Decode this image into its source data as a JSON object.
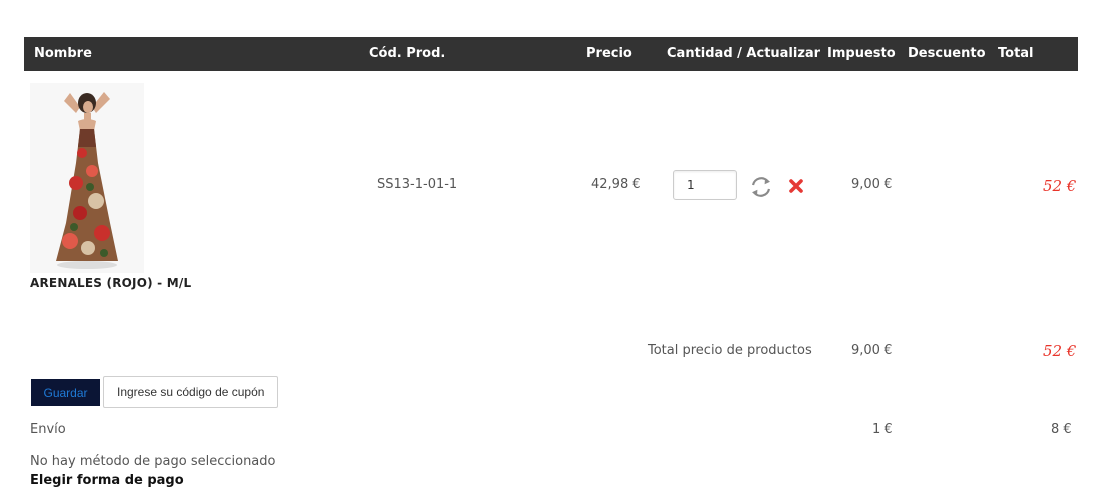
{
  "table": {
    "headers": {
      "name": "Nombre",
      "code": "Cód. Prod.",
      "price": "Precio",
      "quantity": "Cantidad / Actualizar",
      "tax": "Impuesto",
      "discount": "Descuento",
      "total": "Total"
    },
    "rows": [
      {
        "product_name": "ARENALES (ROJO) - M/L",
        "code": "SS13-1-01-1",
        "price": "42,98 €",
        "quantity": "1",
        "tax": "9,00 €",
        "total": "52 €"
      }
    ]
  },
  "icons": {
    "refresh": "refresh-icon",
    "remove": "close-icon"
  },
  "summary": {
    "label": "Total precio de productos",
    "tax": "9,00 €",
    "total": "52 €"
  },
  "coupon": {
    "save_label": "Guardar",
    "placeholder": "Ingrese su código de cupón"
  },
  "shipping": {
    "label": "Envío",
    "tax": "1 €",
    "total": "8 €"
  },
  "payment": {
    "status": "No hay método de pago seleccionado",
    "choose_link": "Elegir forma de pago"
  },
  "colors": {
    "header_bg": "#333333",
    "total_accent": "#e8342a",
    "save_button_bg": "#0b1535",
    "save_button_text": "#1f7ad6"
  }
}
